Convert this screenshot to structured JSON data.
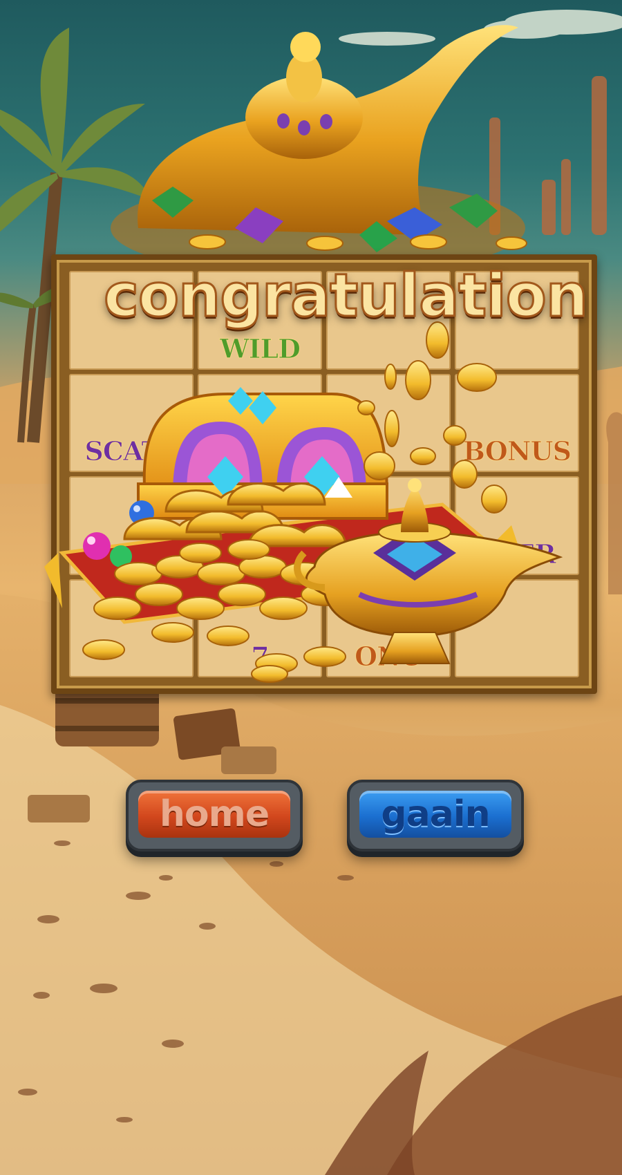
{
  "screen": {
    "title": "congratulation"
  },
  "reel_symbols": [
    {
      "label": ""
    },
    {
      "label": "WILD"
    },
    {
      "label": ""
    },
    {
      "label": ""
    },
    {
      "label": "SCATT"
    },
    {
      "label": ""
    },
    {
      "label": ""
    },
    {
      "label": "BONUS"
    },
    {
      "label": ""
    },
    {
      "label": ""
    },
    {
      "label": ""
    },
    {
      "label": "TTER"
    },
    {
      "label": ""
    },
    {
      "label": "7"
    },
    {
      "label": "ONU"
    },
    {
      "label": ""
    }
  ],
  "buttons": {
    "home_label": "home",
    "again_label": "gaain"
  },
  "colors": {
    "title_fill": "#fbe4a2",
    "title_outline": "#a2581b",
    "home_button": "#d2471d",
    "again_button": "#1b6fd0",
    "gold": "#f2bb2c"
  },
  "icons": [
    "magic-lamp-icon",
    "treasure-chest-icon",
    "gold-coin-icon",
    "gem-icon",
    "palm-tree-icon"
  ]
}
